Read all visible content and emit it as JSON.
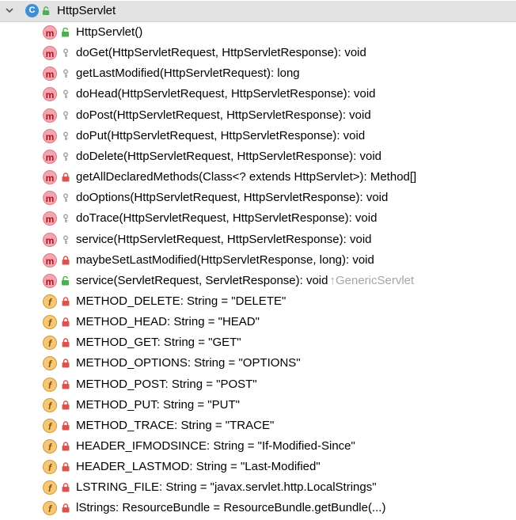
{
  "tree": {
    "root": {
      "title": "HttpServlet",
      "class_icon": "class-icon",
      "modifier_icon": "public-icon",
      "expand_icon": "chevron-down-icon"
    },
    "members": [
      {
        "kind": "m",
        "modifier": "public",
        "signature": "HttpServlet()",
        "inherited": ""
      },
      {
        "kind": "m",
        "modifier": "protected",
        "signature": "doGet(HttpServletRequest, HttpServletResponse): void",
        "inherited": ""
      },
      {
        "kind": "m",
        "modifier": "protected",
        "signature": "getLastModified(HttpServletRequest): long",
        "inherited": ""
      },
      {
        "kind": "m",
        "modifier": "protected",
        "signature": "doHead(HttpServletRequest, HttpServletResponse): void",
        "inherited": ""
      },
      {
        "kind": "m",
        "modifier": "protected",
        "signature": "doPost(HttpServletRequest, HttpServletResponse): void",
        "inherited": ""
      },
      {
        "kind": "m",
        "modifier": "protected",
        "signature": "doPut(HttpServletRequest, HttpServletResponse): void",
        "inherited": ""
      },
      {
        "kind": "m",
        "modifier": "protected",
        "signature": "doDelete(HttpServletRequest, HttpServletResponse): void",
        "inherited": ""
      },
      {
        "kind": "m",
        "modifier": "private",
        "signature": "getAllDeclaredMethods(Class<? extends HttpServlet>): Method[]",
        "inherited": ""
      },
      {
        "kind": "m",
        "modifier": "protected",
        "signature": "doOptions(HttpServletRequest, HttpServletResponse): void",
        "inherited": ""
      },
      {
        "kind": "m",
        "modifier": "protected",
        "signature": "doTrace(HttpServletRequest, HttpServletResponse): void",
        "inherited": ""
      },
      {
        "kind": "m",
        "modifier": "protected",
        "signature": "service(HttpServletRequest, HttpServletResponse): void",
        "inherited": ""
      },
      {
        "kind": "m",
        "modifier": "private",
        "signature": "maybeSetLastModified(HttpServletResponse, long): void",
        "inherited": ""
      },
      {
        "kind": "m",
        "modifier": "public",
        "signature": "service(ServletRequest, ServletResponse): void",
        "inherited": "↑GenericServlet"
      },
      {
        "kind": "f",
        "modifier": "private",
        "signature": "METHOD_DELETE: String = \"DELETE\"",
        "inherited": ""
      },
      {
        "kind": "f",
        "modifier": "private",
        "signature": "METHOD_HEAD: String = \"HEAD\"",
        "inherited": ""
      },
      {
        "kind": "f",
        "modifier": "private",
        "signature": "METHOD_GET: String = \"GET\"",
        "inherited": ""
      },
      {
        "kind": "f",
        "modifier": "private",
        "signature": "METHOD_OPTIONS: String = \"OPTIONS\"",
        "inherited": ""
      },
      {
        "kind": "f",
        "modifier": "private",
        "signature": "METHOD_POST: String = \"POST\"",
        "inherited": ""
      },
      {
        "kind": "f",
        "modifier": "private",
        "signature": "METHOD_PUT: String = \"PUT\"",
        "inherited": ""
      },
      {
        "kind": "f",
        "modifier": "private",
        "signature": "METHOD_TRACE: String = \"TRACE\"",
        "inherited": ""
      },
      {
        "kind": "f",
        "modifier": "private",
        "signature": "HEADER_IFMODSINCE: String = \"If-Modified-Since\"",
        "inherited": ""
      },
      {
        "kind": "f",
        "modifier": "private",
        "signature": "HEADER_LASTMOD: String = \"Last-Modified\"",
        "inherited": ""
      },
      {
        "kind": "f",
        "modifier": "private",
        "signature": "LSTRING_FILE: String = \"javax.servlet.http.LocalStrings\"",
        "inherited": ""
      },
      {
        "kind": "f",
        "modifier": "private",
        "signature": "lStrings: ResourceBundle = ResourceBundle.getBundle(...)",
        "inherited": ""
      }
    ]
  },
  "colors": {
    "selection_bg": "#e3e3e3",
    "method_icon": "#f1a6b0",
    "field_icon": "#f4c878",
    "private_lock": "#d9534f",
    "protected_key": "#a0a0a0",
    "public_open_lock": "#4caf50",
    "inherited_text": "#a6a6a6"
  }
}
